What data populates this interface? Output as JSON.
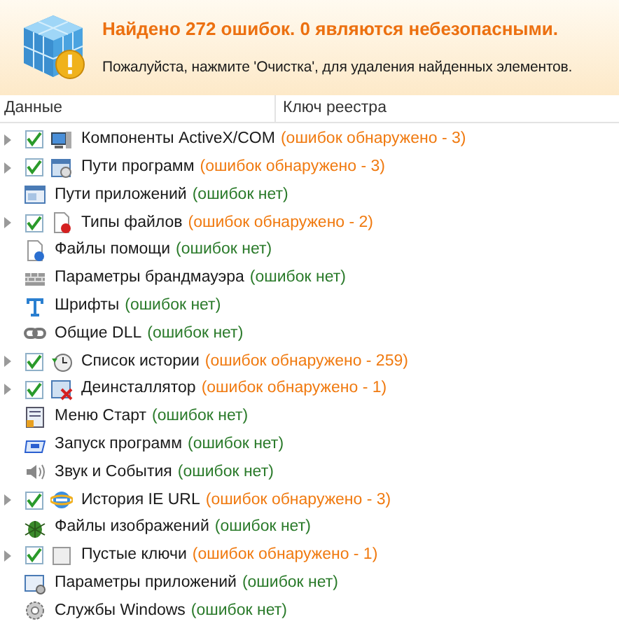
{
  "banner": {
    "title": "Найдено 272 ошибок. 0 являются небезопасными.",
    "message": "Пожалуйста, нажмите 'Очистка', для удаления найденных элементов."
  },
  "table": {
    "columns": [
      "Данные",
      "Ключ реестра"
    ],
    "rows": [
      {
        "kind": "error",
        "checked": true,
        "name": "Компоненты ActiveX/COM",
        "status": "(ошибок обнаружено - 3)"
      },
      {
        "kind": "error",
        "checked": true,
        "name": "Пути программ",
        "status": "(ошибок обнаружено - 3)"
      },
      {
        "kind": "clean",
        "name": "Пути приложений",
        "status": "(ошибок нет)"
      },
      {
        "kind": "error",
        "checked": true,
        "name": "Типы файлов",
        "status": "(ошибок обнаружено - 2)"
      },
      {
        "kind": "clean",
        "name": "Файлы помощи",
        "status": "(ошибок нет)"
      },
      {
        "kind": "clean",
        "name": "Параметры брандмауэра",
        "status": "(ошибок нет)"
      },
      {
        "kind": "clean",
        "name": "Шрифты",
        "status": "(ошибок нет)"
      },
      {
        "kind": "clean",
        "name": "Общие DLL",
        "status": "(ошибок нет)"
      },
      {
        "kind": "error",
        "checked": true,
        "name": "Список истории",
        "status": "(ошибок обнаружено - 259)"
      },
      {
        "kind": "error",
        "checked": true,
        "name": "Деинсталлятор",
        "status": "(ошибок обнаружено - 1)"
      },
      {
        "kind": "clean",
        "name": "Меню Старт",
        "status": "(ошибок нет)"
      },
      {
        "kind": "clean",
        "name": "Запуск программ",
        "status": "(ошибок нет)"
      },
      {
        "kind": "clean",
        "name": "Звук и События",
        "status": "(ошибок нет)"
      },
      {
        "kind": "error",
        "checked": true,
        "name": "История IE URL",
        "status": "(ошибок обнаружено - 3)"
      },
      {
        "kind": "clean",
        "name": "Файлы изображений",
        "status": "(ошибок нет)"
      },
      {
        "kind": "error",
        "checked": true,
        "name": "Пустые ключи",
        "status": "(ошибок обнаружено - 1)"
      },
      {
        "kind": "clean",
        "name": "Параметры приложений",
        "status": "(ошибок нет)"
      },
      {
        "kind": "clean",
        "name": "Службы Windows",
        "status": "(ошибок нет)"
      }
    ]
  }
}
